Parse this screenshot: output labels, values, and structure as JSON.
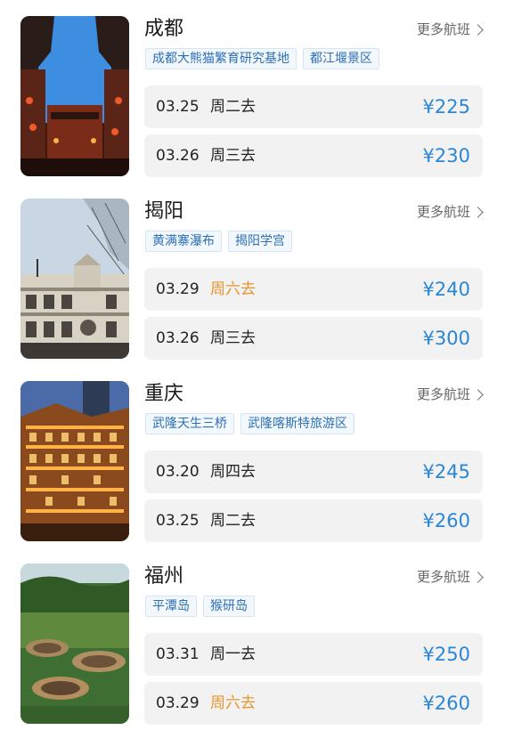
{
  "more_label": "更多航班",
  "currency": "¥",
  "cards": [
    {
      "city": "成都",
      "tags": [
        "成都大熊猫繁育研究基地",
        "都江堰景区"
      ],
      "image": "chengdu-ancient-street-photo",
      "flights": [
        {
          "date": "03.25",
          "day": "周二去",
          "weekend": false,
          "price": "¥225"
        },
        {
          "date": "03.26",
          "day": "周三去",
          "weekend": false,
          "price": "¥230"
        }
      ]
    },
    {
      "city": "揭阳",
      "tags": [
        "黄满寨瀑布",
        "揭阳学宫"
      ],
      "image": "jieyang-arcade-building-photo",
      "flights": [
        {
          "date": "03.29",
          "day": "周六去",
          "weekend": true,
          "price": "¥240"
        },
        {
          "date": "03.26",
          "day": "周三去",
          "weekend": false,
          "price": "¥300"
        }
      ]
    },
    {
      "city": "重庆",
      "tags": [
        "武隆天生三桥",
        "武隆喀斯特旅游区"
      ],
      "image": "chongqing-hongyadong-night-photo",
      "flights": [
        {
          "date": "03.20",
          "day": "周四去",
          "weekend": false,
          "price": "¥245"
        },
        {
          "date": "03.25",
          "day": "周二去",
          "weekend": false,
          "price": "¥260"
        }
      ]
    },
    {
      "city": "福州",
      "tags": [
        "平潭岛",
        "猴研岛"
      ],
      "image": "fuzhou-tulou-photo",
      "flights": [
        {
          "date": "03.31",
          "day": "周一去",
          "weekend": false,
          "price": "¥250"
        },
        {
          "date": "03.29",
          "day": "周六去",
          "weekend": true,
          "price": "¥260"
        }
      ]
    }
  ],
  "colors": {
    "price": "#2a86d6",
    "weekend": "#e8942c",
    "tag_text": "#2d6fb7",
    "row_bg": "#f2f2f2"
  }
}
